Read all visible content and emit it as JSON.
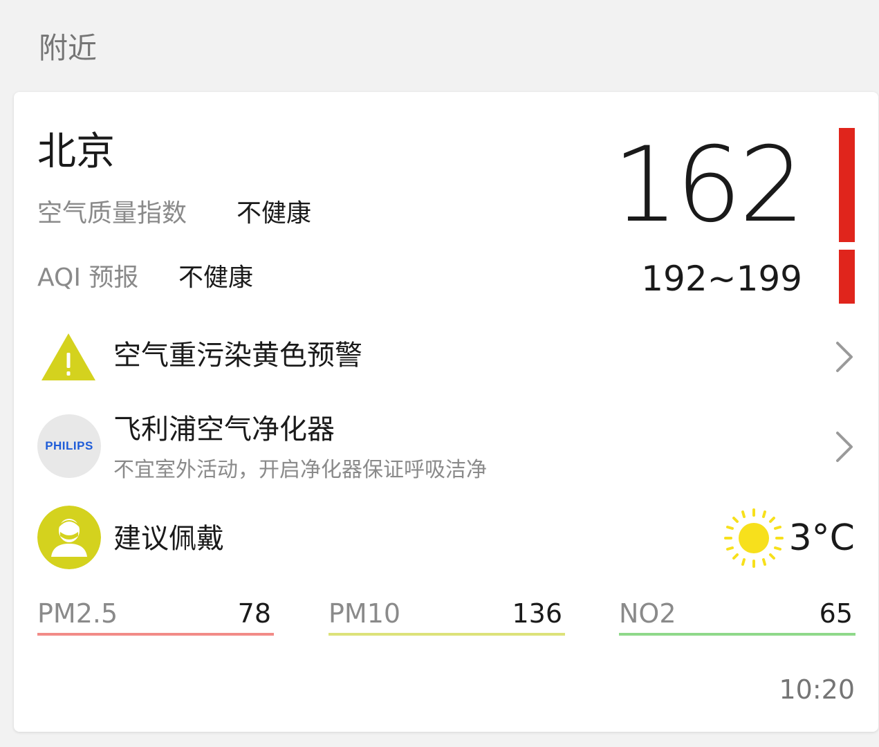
{
  "header": {
    "section_title": "附近"
  },
  "card": {
    "city": "北京",
    "aqi_label": "空气质量指数",
    "aqi_status": "不健康",
    "aqi_value": "162",
    "forecast_label": "AQI 预报",
    "forecast_status": "不健康",
    "forecast_range": "192~199",
    "level_color": "#e0251c",
    "alert": {
      "title": "空气重污染黄色预警",
      "icon": "warning-triangle-icon",
      "icon_color": "#d4d21e"
    },
    "purifier": {
      "brand": "PHILIPS",
      "title": "飞利浦空气净化器",
      "subtitle": "不宜室外活动，开启净化器保证呼吸洁净"
    },
    "mask": {
      "title": "建议佩戴",
      "icon": "mask-person-icon",
      "icon_color": "#d4d21e"
    },
    "weather": {
      "icon": "sun-icon",
      "temperature": "3°C"
    },
    "pollutants": [
      {
        "name": "PM2.5",
        "value": "78",
        "color": "#f28b87"
      },
      {
        "name": "PM10",
        "value": "136",
        "color": "#dde27a"
      },
      {
        "name": "NO2",
        "value": "65",
        "color": "#8fd98a"
      }
    ],
    "updated_time": "10:20"
  }
}
